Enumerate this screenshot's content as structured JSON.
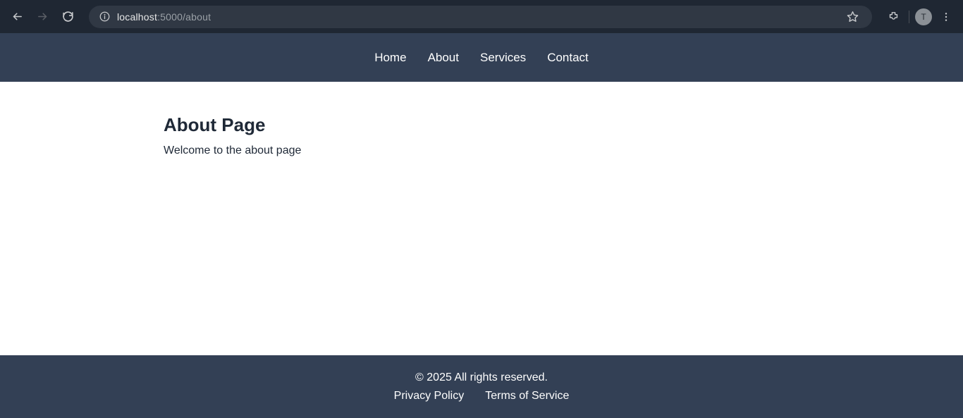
{
  "browser": {
    "url_host": "localhost",
    "url_path": ":5000/about",
    "profile_initial": "T"
  },
  "nav": {
    "items": [
      {
        "label": "Home"
      },
      {
        "label": "About"
      },
      {
        "label": "Services"
      },
      {
        "label": "Contact"
      }
    ]
  },
  "main": {
    "heading": "About Page",
    "body": "Welcome to the about page"
  },
  "footer": {
    "copyright": "© 2025 All rights reserved.",
    "links": [
      {
        "label": "Privacy Policy"
      },
      {
        "label": "Terms of Service"
      }
    ]
  }
}
